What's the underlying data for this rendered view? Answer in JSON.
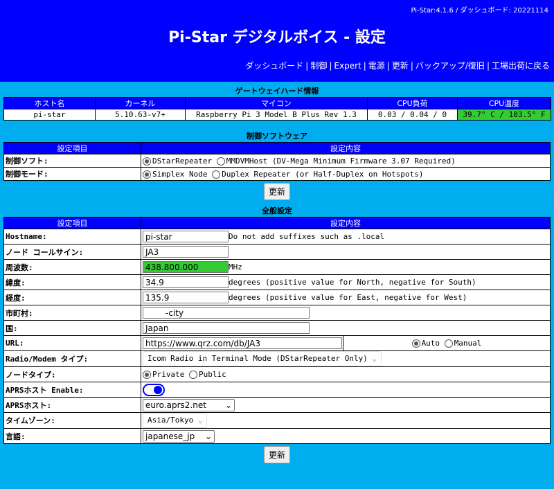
{
  "header": {
    "version": "Pi-Star:4.1.6 / ダッシュボード: 20221114",
    "title": "Pi-Star デジタルボイス - 設定",
    "nav": [
      "ダッシュボード",
      "制御",
      "Expert",
      "電源",
      "更新",
      "バックアップ/復旧",
      "工場出荷に戻る"
    ]
  },
  "hardware": {
    "title": "ゲートウェイハード情報",
    "headers": [
      "ホスト名",
      "カーネル",
      "マイコン",
      "CPU負荷",
      "CPU温度"
    ],
    "row": [
      "pi-star",
      "5.10.63-v7+",
      "Raspberry Pi 3 Model B Plus Rev 1.3",
      "0.03 / 0.04 / 0",
      "39.7° C / 103.5° F"
    ]
  },
  "control": {
    "title": "制御ソフトウェア",
    "headers": [
      "設定項目",
      "設定内容"
    ],
    "software_label": "制御ソフト:",
    "software_opt1": "DStarRepeater",
    "software_opt2": "MMDVMHost (DV-Mega Minimum Firmware 3.07 Required)",
    "mode_label": "制御モード:",
    "mode_opt1": "Simplex Node",
    "mode_opt2": "Duplex Repeater (or Half-Duplex on Hotspots)",
    "update_button": "更新"
  },
  "general": {
    "title": "全般設定",
    "headers": [
      "設定項目",
      "設定内容"
    ],
    "hostname_label": "Hostname:",
    "hostname_value": "pi-star",
    "hostname_note": "Do not add suffixes such as .local",
    "callsign_label": "ノード コールサイン:",
    "callsign_value": "JA3",
    "freq_label": "周波数:",
    "freq_value": "438.800.000",
    "freq_unit": "MHz",
    "lat_label": "緯度:",
    "lat_value": "34.9",
    "lat_note": "degrees (positive value for North, negative for South)",
    "lon_label": "経度:",
    "lon_value": "135.9",
    "lon_note": "degrees (positive value for East, negative for West)",
    "city_label": "市町村:",
    "city_value": "-city",
    "country_label": "国:",
    "country_value": "Japan",
    "url_label": "URL:",
    "url_value": "https://www.qrz.com/db/JA3",
    "url_auto": "Auto",
    "url_manual": "Manual",
    "radio_label": "Radio/Modem タイプ:",
    "radio_value": "Icom Radio in Terminal Mode (DStarRepeater Only)",
    "nodetype_label": "ノードタイプ:",
    "nodetype_private": "Private",
    "nodetype_public": "Public",
    "aprs_enable_label": "APRSホスト Enable:",
    "aprs_host_label": "APRSホスト:",
    "aprs_host_value": "euro.aprs2.net",
    "timezone_label": "タイムゾーン:",
    "timezone_value": "Asia/Tokyo",
    "language_label": "言語:",
    "language_value": "japanese_jp",
    "update_button": "更新"
  },
  "colors": {
    "header_bg": "#0000FF",
    "page_bg": "#00ADEF",
    "highlight": "#33CC33"
  }
}
